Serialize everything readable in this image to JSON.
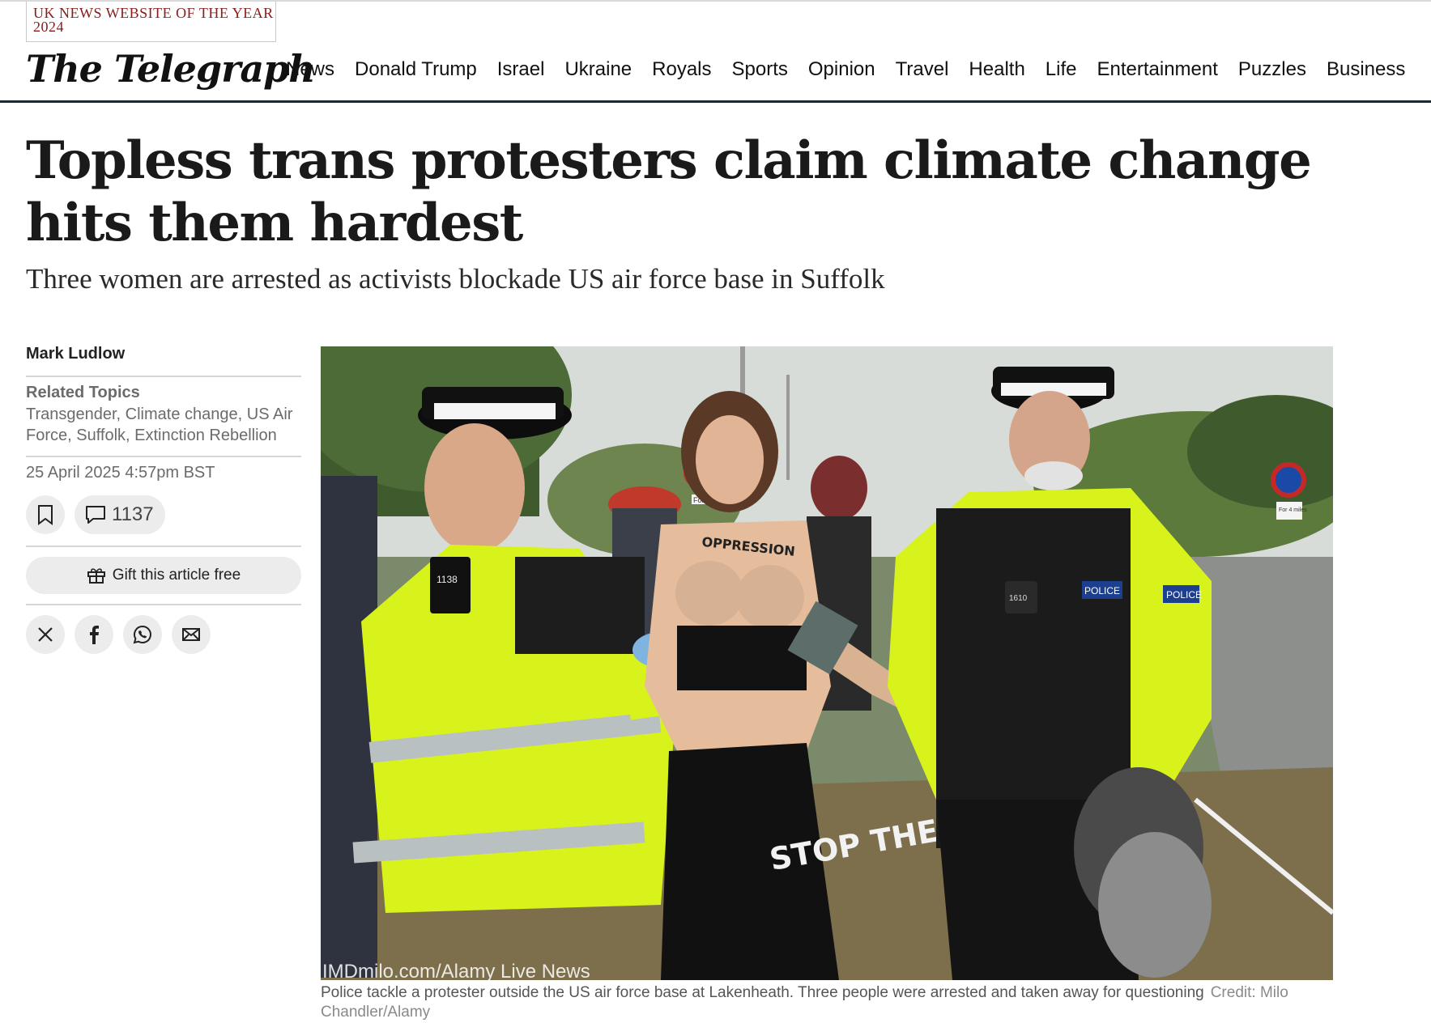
{
  "header": {
    "award": "UK NEWS WEBSITE OF THE YEAR 2024",
    "logo": "The Telegraph",
    "nav": [
      "News",
      "Donald Trump",
      "Israel",
      "Ukraine",
      "Royals",
      "Sports",
      "Opinion",
      "Travel",
      "Health",
      "Life",
      "Entertainment",
      "Puzzles",
      "Business"
    ]
  },
  "article": {
    "headline": "Topless trans protesters claim climate change hits them hardest",
    "standfirst": "Three women are arrested as activists blockade US air force base in Suffolk",
    "author": "Mark Ludlow",
    "related_topics_label": "Related Topics",
    "related_topics": "Transgender, Climate change, US Air Force, Suffolk, Extinction Rebellion",
    "date": "25 April 2025 4:57pm BST",
    "comment_count": "1137",
    "gift_label": "Gift this article free",
    "image": {
      "watermark": "IMDmilo.com/Alamy Live News",
      "body_text": "OPPRESSION",
      "trousers_text": "STOP THE HA",
      "badge_left": "1138",
      "badge_right": "1610",
      "vest_left": "POLICE",
      "vest_right": "POLICE",
      "sign_small": "For 4 miles",
      "sign_left": "For"
    },
    "caption": "Police tackle a protester outside the US air force base at Lakenheath. Three people were arrested and taken away for questioning",
    "credit": "Credit: Milo Chandler/Alamy"
  },
  "icons": {
    "bookmark": "bookmark-icon",
    "comment": "comment-icon",
    "gift": "gift-icon",
    "x": "x-icon",
    "facebook": "facebook-icon",
    "whatsapp": "whatsapp-icon",
    "email": "email-icon"
  },
  "colors": {
    "award_text": "#8a1b1b",
    "nav_rule": "#1b2a30",
    "muted_text": "#6b6b6b",
    "button_bg": "#ececec",
    "hi_vis": "#d8f21c"
  }
}
